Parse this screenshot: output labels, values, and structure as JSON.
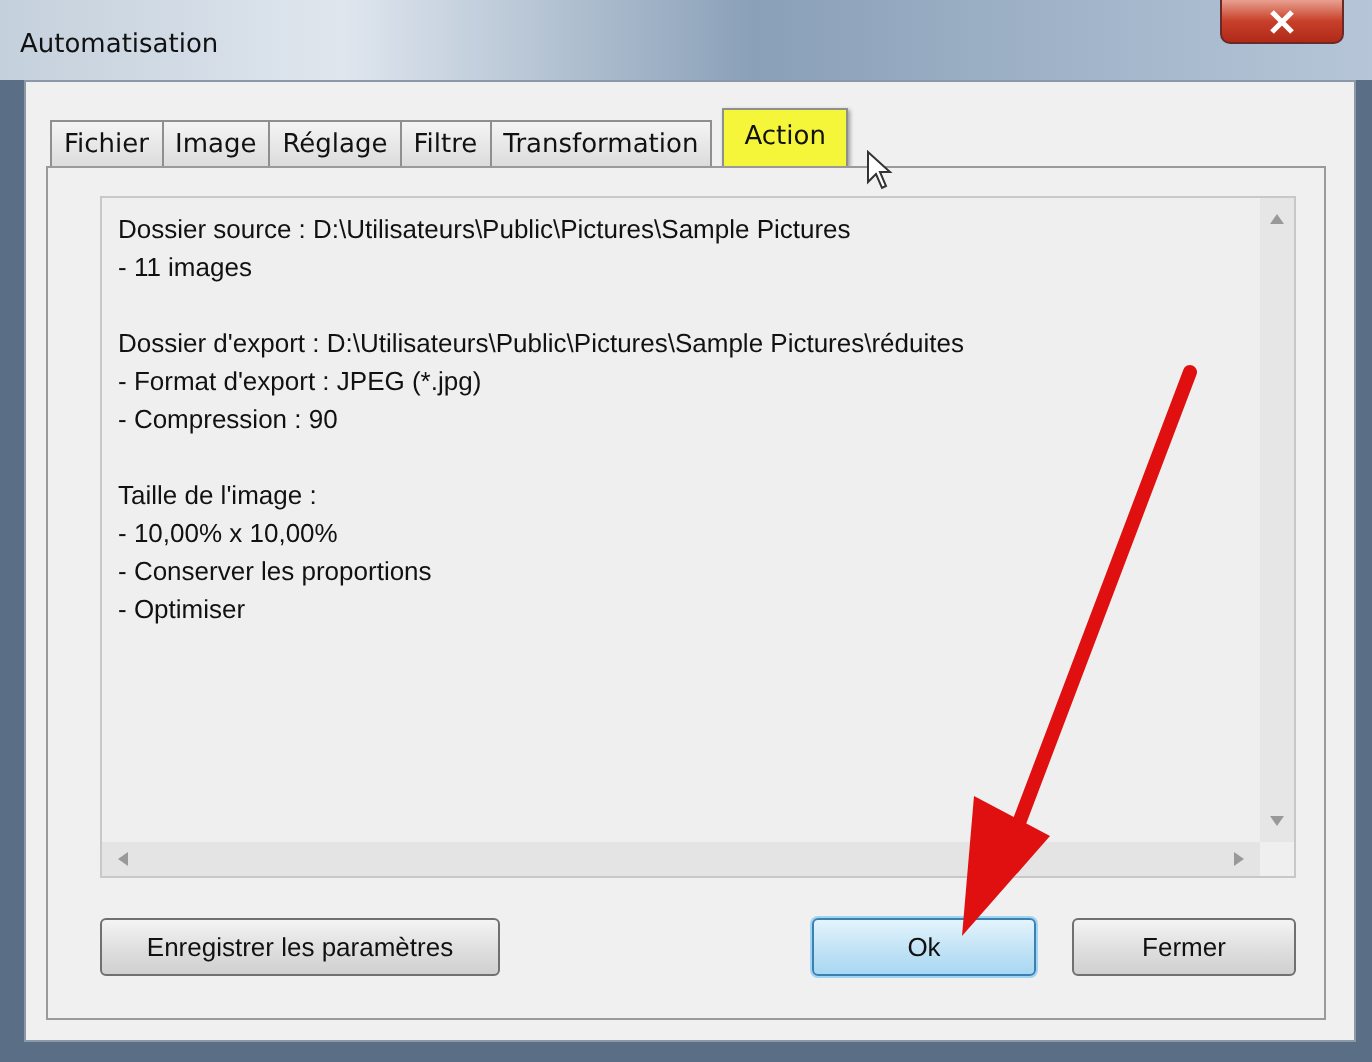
{
  "window": {
    "title": "Automatisation"
  },
  "tabs": [
    {
      "label": "Fichier",
      "selected": false
    },
    {
      "label": "Image",
      "selected": false
    },
    {
      "label": "Réglage",
      "selected": false
    },
    {
      "label": "Filtre",
      "selected": false
    },
    {
      "label": "Transformation",
      "selected": false
    },
    {
      "label": "Action",
      "selected": true
    }
  ],
  "summary": [
    [
      "Dossier source : D:\\Utilisateurs\\Public\\Pictures\\Sample Pictures",
      "- 11 images"
    ],
    [
      "Dossier d'export : D:\\Utilisateurs\\Public\\Pictures\\Sample Pictures\\réduites",
      "- Format d'export : JPEG (*.jpg)",
      "- Compression : 90"
    ],
    [
      "Taille de l'image :",
      "- 10,00% x 10,00%",
      "- Conserver les proportions",
      "- Optimiser"
    ]
  ],
  "buttons": [
    {
      "label": "Enregistrer les paramètres",
      "kind": "normal"
    },
    {
      "label": "Ok",
      "kind": "default"
    },
    {
      "label": "Fermer",
      "kind": "normal"
    }
  ]
}
